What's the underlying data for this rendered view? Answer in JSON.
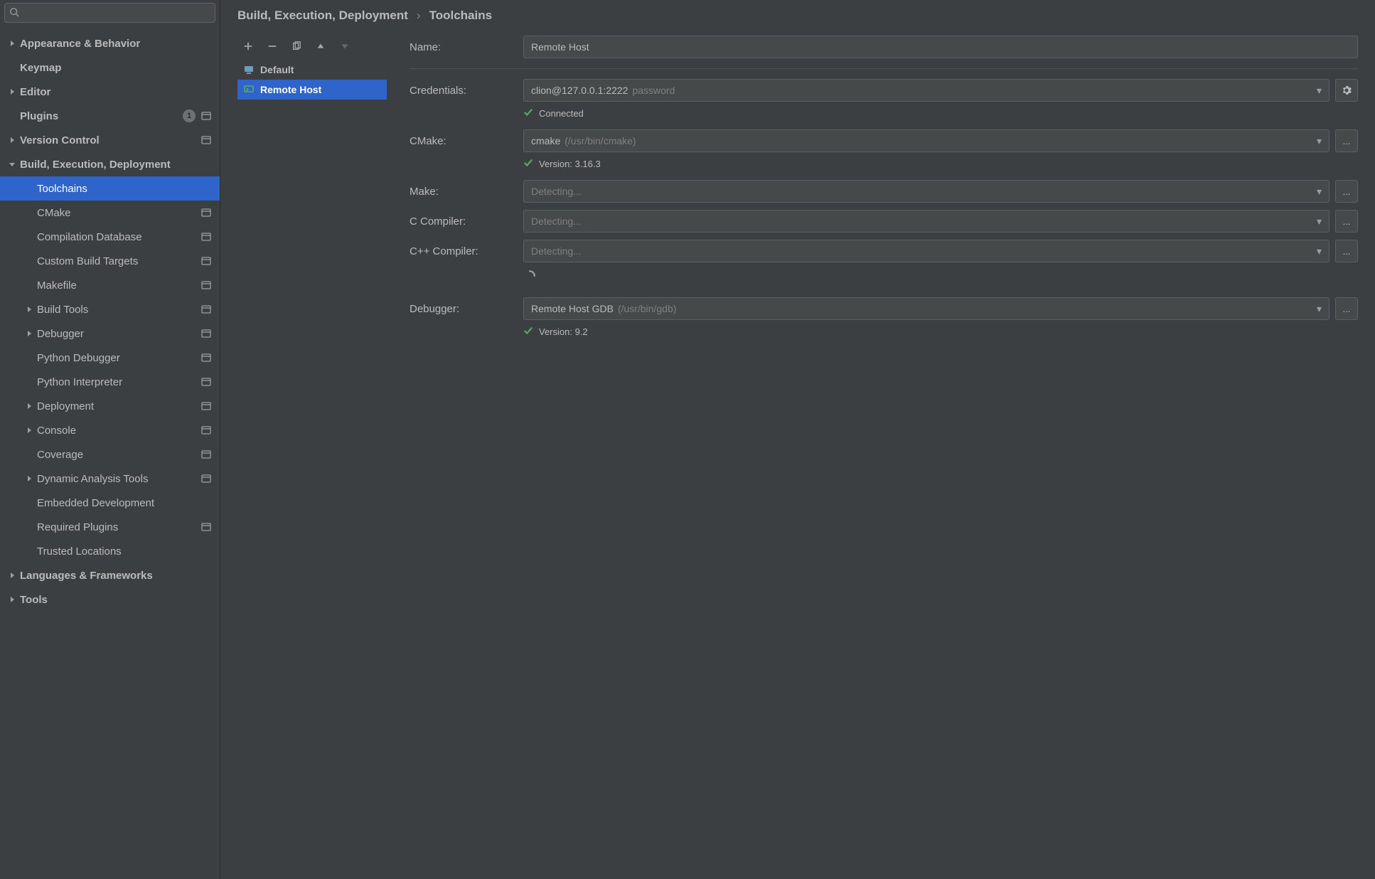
{
  "search": {
    "placeholder": ""
  },
  "sidebar": {
    "items": [
      {
        "label": "Appearance & Behavior",
        "level": 0,
        "expandable": true,
        "expanded": false
      },
      {
        "label": "Keymap",
        "level": 0,
        "expandable": false
      },
      {
        "label": "Editor",
        "level": 0,
        "expandable": true,
        "expanded": false
      },
      {
        "label": "Plugins",
        "level": 0,
        "expandable": false,
        "badge": "1",
        "extra": true
      },
      {
        "label": "Version Control",
        "level": 0,
        "expandable": true,
        "expanded": false,
        "extra": true
      },
      {
        "label": "Build, Execution, Deployment",
        "level": 0,
        "expandable": true,
        "expanded": true
      },
      {
        "label": "Toolchains",
        "level": 1,
        "expandable": false,
        "selected": true
      },
      {
        "label": "CMake",
        "level": 1,
        "expandable": false,
        "extra": true
      },
      {
        "label": "Compilation Database",
        "level": 1,
        "expandable": false,
        "extra": true
      },
      {
        "label": "Custom Build Targets",
        "level": 1,
        "expandable": false,
        "extra": true
      },
      {
        "label": "Makefile",
        "level": 1,
        "expandable": false,
        "extra": true
      },
      {
        "label": "Build Tools",
        "level": 1,
        "expandable": true,
        "expanded": false,
        "extra": true
      },
      {
        "label": "Debugger",
        "level": 1,
        "expandable": true,
        "expanded": false,
        "extra": true
      },
      {
        "label": "Python Debugger",
        "level": 1,
        "expandable": false,
        "extra": true
      },
      {
        "label": "Python Interpreter",
        "level": 1,
        "expandable": false,
        "extra": true
      },
      {
        "label": "Deployment",
        "level": 1,
        "expandable": true,
        "expanded": false,
        "extra": true
      },
      {
        "label": "Console",
        "level": 1,
        "expandable": true,
        "expanded": false,
        "extra": true
      },
      {
        "label": "Coverage",
        "level": 1,
        "expandable": false,
        "extra": true
      },
      {
        "label": "Dynamic Analysis Tools",
        "level": 1,
        "expandable": true,
        "expanded": false,
        "extra": true
      },
      {
        "label": "Embedded Development",
        "level": 1,
        "expandable": false
      },
      {
        "label": "Required Plugins",
        "level": 1,
        "expandable": false,
        "extra": true
      },
      {
        "label": "Trusted Locations",
        "level": 1,
        "expandable": false
      },
      {
        "label": "Languages & Frameworks",
        "level": 0,
        "expandable": true,
        "expanded": false
      },
      {
        "label": "Tools",
        "level": 0,
        "expandable": true,
        "expanded": false
      }
    ]
  },
  "breadcrumb": {
    "a": "Build, Execution, Deployment",
    "b": "Toolchains"
  },
  "toolchains": {
    "items": [
      {
        "label": "Default",
        "icon": "system-icon"
      },
      {
        "label": "Remote Host",
        "icon": "remote-icon",
        "selected": true
      }
    ]
  },
  "form": {
    "name_label": "Name:",
    "name_value": "Remote Host",
    "credentials_label": "Credentials:",
    "credentials_value": "clion@127.0.0.1:2222",
    "credentials_hint": "password",
    "connected_label": "Connected",
    "cmake_label": "CMake:",
    "cmake_value": "cmake",
    "cmake_path": "(/usr/bin/cmake)",
    "cmake_version": "Version: 3.16.3",
    "make_label": "Make:",
    "make_placeholder": "Detecting...",
    "ccomp_label": "C Compiler:",
    "ccomp_placeholder": "Detecting...",
    "cxxcomp_label": "C++ Compiler:",
    "cxxcomp_placeholder": "Detecting...",
    "debugger_label": "Debugger:",
    "debugger_value": "Remote Host GDB",
    "debugger_path": "(/usr/bin/gdb)",
    "debugger_version": "Version: 9.2",
    "browse": "..."
  }
}
